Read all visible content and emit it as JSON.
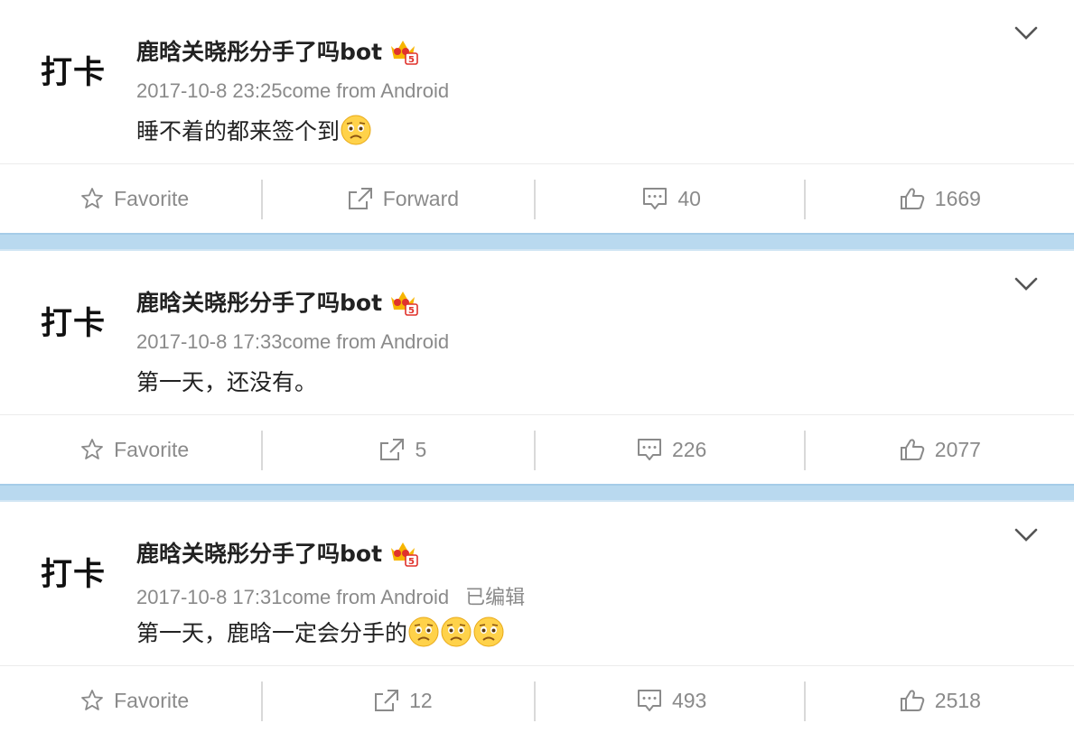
{
  "posts": [
    {
      "avatar_text": "打卡",
      "username": "鹿晗关晓彤分手了吗bot",
      "timestamp": "2017-10-8 23:25",
      "source": "come from Android",
      "edited": "",
      "content": "睡不着的都来签个到",
      "emoji_count": 1,
      "actions": {
        "favorite": "Favorite",
        "forward": "Forward",
        "comments": "40",
        "likes": "1669"
      }
    },
    {
      "avatar_text": "打卡",
      "username": "鹿晗关晓彤分手了吗bot",
      "timestamp": "2017-10-8 17:33",
      "source": "come from Android",
      "edited": "",
      "content": "第一天，还没有。",
      "emoji_count": 0,
      "actions": {
        "favorite": "Favorite",
        "forward": "5",
        "comments": "226",
        "likes": "2077"
      }
    },
    {
      "avatar_text": "打卡",
      "username": "鹿晗关晓彤分手了吗bot",
      "timestamp": "2017-10-8 17:31",
      "source": "come from Android",
      "edited": "已编辑",
      "content": "第一天，鹿晗一定会分手的",
      "emoji_count": 3,
      "actions": {
        "favorite": "Favorite",
        "forward": "12",
        "comments": "493",
        "likes": "2518"
      }
    }
  ],
  "colors": {
    "separator": "#b9d9ef",
    "meta_text": "#8a8a8a",
    "username": "#222222"
  },
  "icons": [
    "vip-crown-icon",
    "sad-emoji-icon",
    "chevron-down-icon",
    "star-icon",
    "forward-icon",
    "comment-icon",
    "thumbs-up-icon"
  ]
}
